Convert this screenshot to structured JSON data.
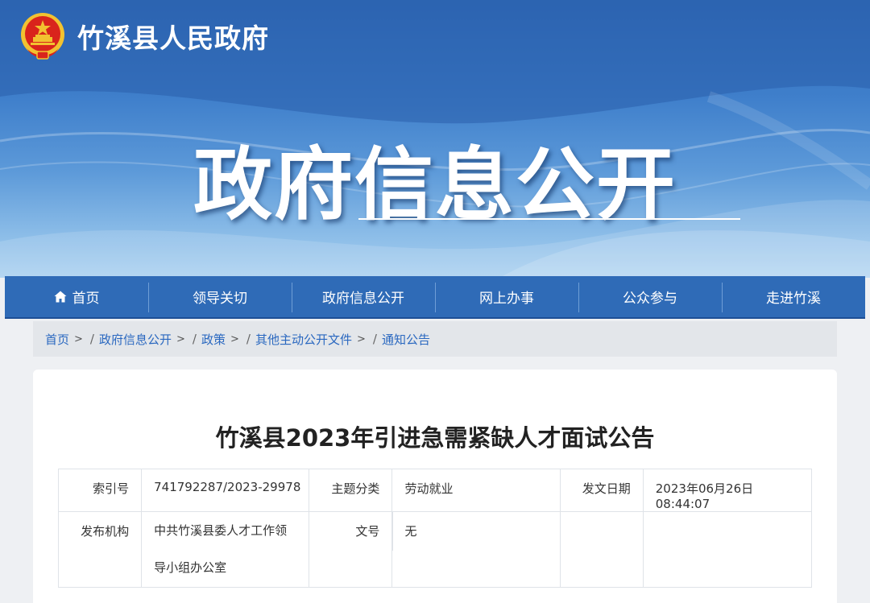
{
  "site": {
    "name": "竹溪县人民政府",
    "emblem_icon": "national-emblem-icon"
  },
  "hero": {
    "title": "政府信息公开"
  },
  "nav": {
    "items": [
      {
        "label": "首页",
        "icon": "home-icon"
      },
      {
        "label": "领导关切"
      },
      {
        "label": "政府信息公开"
      },
      {
        "label": "网上办事"
      },
      {
        "label": "公众参与"
      },
      {
        "label": "走进竹溪"
      }
    ]
  },
  "breadcrumb": {
    "items": [
      "首页",
      "政府信息公开",
      "政策",
      "其他主动公开文件",
      "通知公告"
    ],
    "separator": ">",
    "slash": "/"
  },
  "document": {
    "title": "竹溪县2023年引进急需紧缺人才面试公告",
    "meta": {
      "index_label": "索引号",
      "index_value": "741792287/2023-29978",
      "topic_label": "主题分类",
      "topic_value": "劳动就业",
      "date_label": "发文日期",
      "date_value": "2023年06月26日 08:44:07",
      "publisher_label": "发布机构",
      "publisher_value_line1": "中共竹溪县委人才工作领",
      "publisher_value_line2": "导小组办公室",
      "docno_label": "文号",
      "docno_value": "无"
    }
  },
  "colors": {
    "nav_bg": "#2f6bb7",
    "link": "#2a68c0",
    "emblem_red": "#d9241c",
    "emblem_gold": "#f2c230"
  }
}
